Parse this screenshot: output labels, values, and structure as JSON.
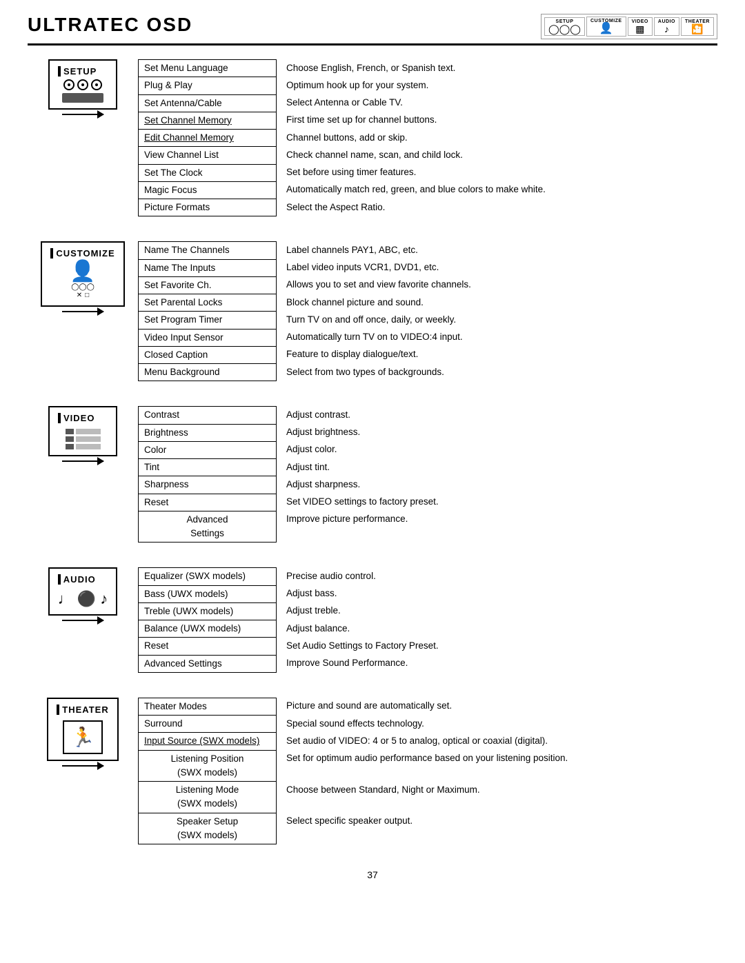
{
  "page": {
    "title": "ULTRATEC OSD",
    "page_number": "37"
  },
  "header_icons": [
    {
      "label": "SETUP",
      "shape": "⚙"
    },
    {
      "label": "CUSTOMIZE",
      "shape": "👤"
    },
    {
      "label": "VIDEO",
      "shape": "▦"
    },
    {
      "label": "AUDIO",
      "shape": "♪"
    },
    {
      "label": "THEATER",
      "shape": "🎬"
    }
  ],
  "sections": [
    {
      "id": "setup",
      "label": "SETUP",
      "rows": [
        {
          "item": "Set Menu Language",
          "desc": "Choose English, French, or Spanish text.",
          "underline": false
        },
        {
          "item": "Plug & Play",
          "desc": "Optimum hook up for your system.",
          "underline": false
        },
        {
          "item": "Set Antenna/Cable",
          "desc": "Select Antenna or Cable TV.",
          "underline": false
        },
        {
          "item": "Set Channel Memory",
          "desc": "First time set up for channel buttons.",
          "underline": true
        },
        {
          "item": "Edit Channel Memory",
          "desc": "Channel buttons, add or skip.",
          "underline": true
        },
        {
          "item": "View Channel List",
          "desc": "Check channel name, scan, and child lock.",
          "underline": false
        },
        {
          "item": "Set The Clock",
          "desc": "Set before using timer features.",
          "underline": false
        },
        {
          "item": "Magic Focus",
          "desc": "Automatically match red, green, and blue colors to make white.",
          "underline": false
        },
        {
          "item": "Picture Formats",
          "desc": "Select  the Aspect Ratio.",
          "underline": false
        }
      ]
    },
    {
      "id": "customize",
      "label": "CUSTOMIZE",
      "rows": [
        {
          "item": "Name The Channels",
          "desc": "Label channels PAY1, ABC, etc.",
          "underline": false
        },
        {
          "item": "Name The Inputs",
          "desc": "Label video inputs VCR1, DVD1, etc.",
          "underline": false
        },
        {
          "item": "Set Favorite Ch.",
          "desc": "Allows you to set and view favorite channels.",
          "underline": false
        },
        {
          "item": "Set Parental Locks",
          "desc": "Block channel picture and sound.",
          "underline": false
        },
        {
          "item": "Set Program Timer",
          "desc": "Turn TV on and off once, daily, or weekly.",
          "underline": false
        },
        {
          "item": "Video Input Sensor",
          "desc": "Automatically turn TV on to VIDEO:4 input.",
          "underline": false
        },
        {
          "item": "Closed Caption",
          "desc": "Feature to display dialogue/text.",
          "underline": false
        },
        {
          "item": "Menu Background",
          "desc": "Select from two types of backgrounds.",
          "underline": false
        }
      ]
    },
    {
      "id": "video",
      "label": "VIDEO",
      "rows": [
        {
          "item": "Contrast",
          "desc": "Adjust contrast.",
          "underline": false
        },
        {
          "item": "Brightness",
          "desc": "Adjust brightness.",
          "underline": false
        },
        {
          "item": "Color",
          "desc": "Adjust color.",
          "underline": false
        },
        {
          "item": "Tint",
          "desc": "Adjust tint.",
          "underline": false
        },
        {
          "item": "Sharpness",
          "desc": "Adjust sharpness.",
          "underline": false
        },
        {
          "item": "Reset",
          "desc": "Set VIDEO settings to factory preset.",
          "underline": false
        },
        {
          "item": "Advanced\nSettings",
          "desc": "Improve picture performance.",
          "underline": false
        }
      ]
    },
    {
      "id": "audio",
      "label": "AUDIO",
      "rows": [
        {
          "item": "Equalizer (SWX models)",
          "desc": "Precise audio control.",
          "underline": false
        },
        {
          "item": "Bass (UWX models)",
          "desc": "Adjust bass.",
          "underline": false
        },
        {
          "item": "Treble (UWX models)",
          "desc": "Adjust treble.",
          "underline": false
        },
        {
          "item": "Balance (UWX models)",
          "desc": "Adjust balance.",
          "underline": false
        },
        {
          "item": "Reset",
          "desc": "Set Audio Settings to Factory Preset.",
          "underline": false
        },
        {
          "item": "Advanced Settings",
          "desc": "Improve Sound Performance.",
          "underline": false
        }
      ]
    },
    {
      "id": "theater",
      "label": "THEATER",
      "rows": [
        {
          "item": "Theater Modes",
          "desc": "Picture and sound are automatically set.",
          "underline": false
        },
        {
          "item": "Surround",
          "desc": "Special sound effects technology.",
          "underline": false
        },
        {
          "item": "Input Source (SWX models)",
          "desc": "Set audio of VIDEO: 4 or 5 to analog, optical or coaxial (digital).",
          "underline": true
        },
        {
          "item": "Listening Position\n(SWX models)",
          "desc": "Set for optimum audio performance based on your listening position.",
          "underline": false
        },
        {
          "item": "Listening Mode\n(SWX models)",
          "desc": "Choose between Standard, Night or Maximum.",
          "underline": false
        },
        {
          "item": "Speaker Setup\n(SWX models)",
          "desc": "Select specific speaker output.",
          "underline": false
        }
      ]
    }
  ]
}
